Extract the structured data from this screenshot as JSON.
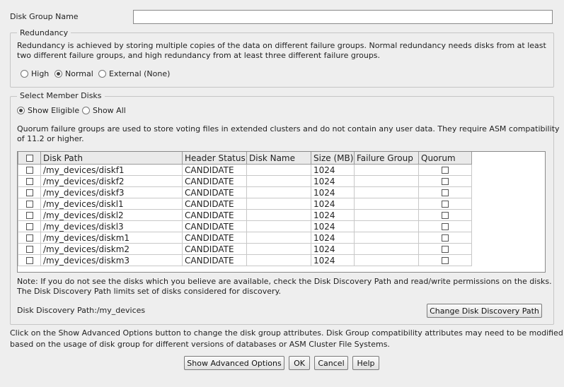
{
  "disk_group_name": {
    "label": "Disk Group Name",
    "value": ""
  },
  "redundancy": {
    "legend": "Redundancy",
    "description_line1": "Redundancy is achieved by storing multiple copies of the data on different failure groups. Normal redundancy needs disks from at least",
    "description_line2": "two different failure groups, and high redundancy from at least three different failure groups.",
    "options": [
      {
        "label": "High",
        "selected": false
      },
      {
        "label": "Normal",
        "selected": true
      },
      {
        "label": "External (None)",
        "selected": false
      }
    ]
  },
  "member_disks": {
    "legend": "Select Member Disks",
    "filters": [
      {
        "label": "Show Eligible",
        "selected": true
      },
      {
        "label": "Show All",
        "selected": false
      }
    ],
    "quorum_note_line1": "Quorum failure groups are used to store voting files in extended clusters and do not contain any user data. They require ASM compatibility",
    "quorum_note_line2": "of 11.2 or higher.",
    "table": {
      "columns": [
        "Disk Path",
        "Header Status",
        "Disk Name",
        "Size (MB)",
        "Failure Group",
        "Quorum"
      ],
      "rows": [
        {
          "path": "/my_devices/diskf1",
          "status": "CANDIDATE",
          "name": "",
          "size": "1024",
          "failure_group": ""
        },
        {
          "path": "/my_devices/diskf2",
          "status": "CANDIDATE",
          "name": "",
          "size": "1024",
          "failure_group": ""
        },
        {
          "path": "/my_devices/diskf3",
          "status": "CANDIDATE",
          "name": "",
          "size": "1024",
          "failure_group": ""
        },
        {
          "path": "/my_devices/diskl1",
          "status": "CANDIDATE",
          "name": "",
          "size": "1024",
          "failure_group": ""
        },
        {
          "path": "/my_devices/diskl2",
          "status": "CANDIDATE",
          "name": "",
          "size": "1024",
          "failure_group": ""
        },
        {
          "path": "/my_devices/diskl3",
          "status": "CANDIDATE",
          "name": "",
          "size": "1024",
          "failure_group": ""
        },
        {
          "path": "/my_devices/diskm1",
          "status": "CANDIDATE",
          "name": "",
          "size": "1024",
          "failure_group": ""
        },
        {
          "path": "/my_devices/diskm2",
          "status": "CANDIDATE",
          "name": "",
          "size": "1024",
          "failure_group": ""
        },
        {
          "path": "/my_devices/diskm3",
          "status": "CANDIDATE",
          "name": "",
          "size": "1024",
          "failure_group": ""
        }
      ]
    },
    "discovery_note_line1": "Note: If you do not see the disks which you believe are available, check the Disk Discovery Path and read/write permissions on the disks.",
    "discovery_note_line2": "The Disk Discovery Path limits set of disks considered for discovery.",
    "discovery_path_text": "Disk Discovery Path:/my_devices",
    "change_path_button": "Change Disk Discovery Path"
  },
  "advanced_note_line1": "Click on the Show Advanced Options button to change the disk group attributes. Disk Group compatibility attributes may need to be modified",
  "advanced_note_line2": "based on the usage of disk group for different versions of databases or ASM Cluster File Systems.",
  "buttons": {
    "advanced": "Show Advanced Options",
    "ok": "OK",
    "cancel": "Cancel",
    "help": "Help"
  }
}
